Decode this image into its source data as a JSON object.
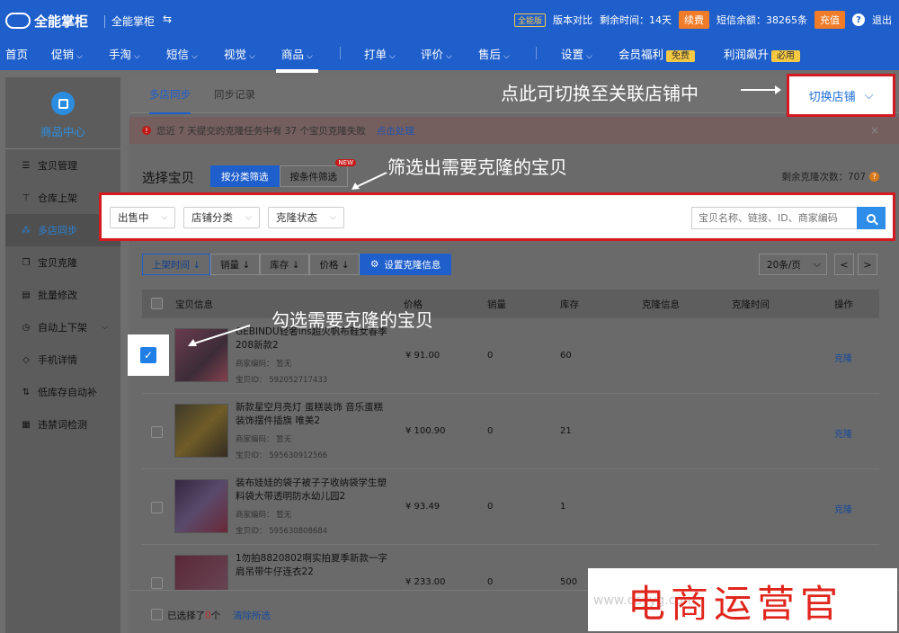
{
  "topbar": {
    "logo": "全能掌柜",
    "brand": "全能掌柜",
    "swap_icon": "⇆",
    "version_badge": "全能版",
    "compare": "版本对比",
    "remaining_time": "剩余时间：14天",
    "renew": "续费",
    "sms_balance": "短信余额：38265条",
    "recharge": "充值",
    "help": "?",
    "logout": "退出"
  },
  "nav": {
    "items": [
      "首页",
      "促销",
      "手淘",
      "短信",
      "视觉",
      "商品",
      "打单",
      "评价",
      "售后",
      "设置",
      "会员福利",
      "利润飙升"
    ],
    "free_tag": "免费",
    "must_tag": "必用",
    "active": "商品"
  },
  "sidebar": {
    "title": "商品中心",
    "items": [
      {
        "label": "宝贝管理",
        "icon": "list-icon"
      },
      {
        "label": "仓库上架",
        "icon": "upload-icon"
      },
      {
        "label": "多店同步",
        "icon": "sync-icon"
      },
      {
        "label": "宝贝克隆",
        "icon": "copy-icon"
      },
      {
        "label": "批量修改",
        "icon": "edit-icon"
      },
      {
        "label": "自动上下架",
        "icon": "clock-icon"
      },
      {
        "label": "手机详情",
        "icon": "tag-icon"
      },
      {
        "label": "低库存自动补",
        "icon": "sort-icon"
      },
      {
        "label": "违禁词检测",
        "icon": "doc-icon"
      }
    ],
    "active": "多店同步"
  },
  "tabs": [
    "多店同步",
    "同步记录"
  ],
  "notice": {
    "text": "您近 7 天提交的克隆任务中有 37 个宝贝克隆失败",
    "link": "点击处理"
  },
  "pick_title": "选择宝贝",
  "filter_modes": {
    "by_category": "按分类筛选",
    "by_condition": "按条件筛选",
    "new_tag": "NEW"
  },
  "remaining_clones": "剩余克隆次数：707",
  "filters": {
    "status": "出售中",
    "shop_category": "店铺分类",
    "clone_status": "克隆状态",
    "search_placeholder": "宝贝名称、链接、ID、商家编码"
  },
  "sort_buttons": [
    "上架时间 ↓",
    "销量 ↓",
    "库存 ↓",
    "价格 ↓"
  ],
  "config_button": "设置克隆信息",
  "page_size": "20条/页",
  "pager": {
    "prev": "<",
    "next": ">"
  },
  "table": {
    "headers": [
      "宝贝信息",
      "价格",
      "销量",
      "库存",
      "克隆信息",
      "克隆时间",
      "操作"
    ],
    "rows": [
      {
        "name": "GEBINDU轻奢ins超火帆布鞋女春季208新款2",
        "code": "商家编码：  暂无",
        "id": "宝贝ID：  592052717433",
        "price": "¥ 91.00",
        "sales": "0",
        "stock": "60",
        "action": "克隆"
      },
      {
        "name": "新款星空月亮灯 蛋糕装饰 音乐蛋糕装饰摆件插旗 唯美2",
        "code": "商家编码：  暂无",
        "id": "宝贝ID：  595630912566",
        "price": "¥ 100.90",
        "sales": "0",
        "stock": "21",
        "action": "克隆"
      },
      {
        "name": "装布娃娃的袋子被子子收纳袋学生塑料袋大带透明防水幼儿园2",
        "code": "商家编码：  暂无",
        "id": "宝贝ID：  595630808684",
        "price": "¥ 93.49",
        "sales": "0",
        "stock": "1",
        "action": "克隆"
      },
      {
        "name": "1勿拍8820802啊实拍夏季新款一字肩吊带牛仔连衣22",
        "code": "",
        "id": "",
        "price": "¥ 233.00",
        "sales": "0",
        "stock": "500",
        "action": "克隆"
      }
    ]
  },
  "footer": {
    "selected_prefix": "已选择了",
    "selected_count": "0",
    "selected_suffix": "个",
    "clear": "清除所选"
  },
  "annotations": {
    "switch_hint": "点此可切换至关联店铺中",
    "switch_button": "切换店铺",
    "filter_hint": "筛选出需要克隆的宝贝",
    "check_hint": "勾选需要克隆的宝贝"
  },
  "watermark": {
    "big": "电商运营官",
    "small": "www.dsyyg.com"
  }
}
